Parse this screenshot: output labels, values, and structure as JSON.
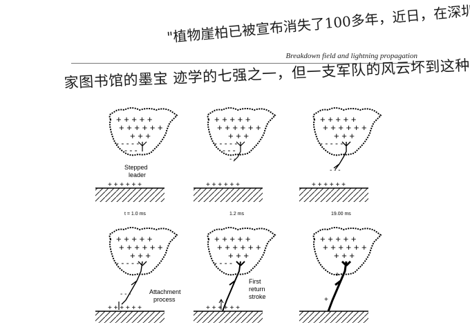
{
  "header": {
    "title": "Breakdown field and lightning propagation"
  },
  "handwriting": {
    "line1": "\"植物崖柏已被宣布消失了100多年，近日，在深圳国",
    "line2": "家图书馆的墨宝 迹学的七强之一，但一支军队的风云坏到这种程"
  },
  "panels": [
    {
      "time_label": "t = 1.0 ms",
      "caption": [
        "Stepped",
        "leader"
      ]
    },
    {
      "time_label": "1.2 ms",
      "caption": []
    },
    {
      "time_label": "19.00 ms",
      "caption": []
    },
    {
      "time_label": "",
      "caption": [
        "Attachment",
        "process"
      ]
    },
    {
      "time_label": "",
      "caption": [
        "First",
        "return",
        "stroke"
      ]
    },
    {
      "time_label": "",
      "caption": []
    }
  ]
}
